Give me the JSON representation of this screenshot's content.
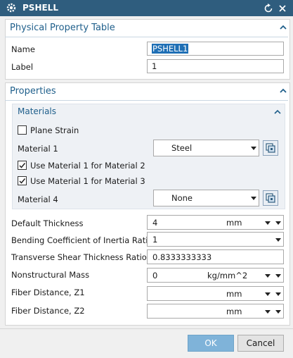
{
  "window": {
    "title": "PSHELL"
  },
  "icons": {
    "title": "gear-icon",
    "reset": "reset-icon",
    "close": "close-icon"
  },
  "physical_table": {
    "header": "Physical Property Table",
    "name_label": "Name",
    "name_value": "PSHELL1",
    "label_label": "Label",
    "label_value": "1"
  },
  "properties": {
    "header": "Properties",
    "materials": {
      "header": "Materials",
      "plane_strain_label": "Plane Strain",
      "plane_strain_checked": false,
      "material1_label": "Material 1",
      "material1_value": "Steel",
      "use_mat1_for_mat2_label": "Use Material 1 for Material 2",
      "use_mat1_for_mat2_checked": true,
      "use_mat1_for_mat3_label": "Use Material 1 for Material 3",
      "use_mat1_for_mat3_checked": true,
      "material4_label": "Material 4",
      "material4_value": "None"
    },
    "default_thickness": {
      "label": "Default Thickness",
      "value": "4",
      "unit": "mm"
    },
    "bending_coeff": {
      "label": "Bending Coefficient of Inertia Ratio",
      "value": "1"
    },
    "transverse_shear": {
      "label": "Transverse Shear Thickness Ratio",
      "value": "0.8333333333"
    },
    "nonstructural_mass": {
      "label": "Nonstructural Mass",
      "value": "0",
      "unit": "kg/mm^2"
    },
    "fiber_z1": {
      "label": "Fiber Distance, Z1",
      "value": "",
      "unit": "mm"
    },
    "fiber_z2": {
      "label": "Fiber Distance, Z2",
      "value": "",
      "unit": "mm"
    }
  },
  "footer": {
    "ok_label": "OK",
    "cancel_label": "Cancel"
  },
  "colors": {
    "titlebar": "#2f5d7e",
    "section_text": "#1f5f8b",
    "ok_button": "#7fb3d9",
    "selection": "#1f6fb5"
  }
}
